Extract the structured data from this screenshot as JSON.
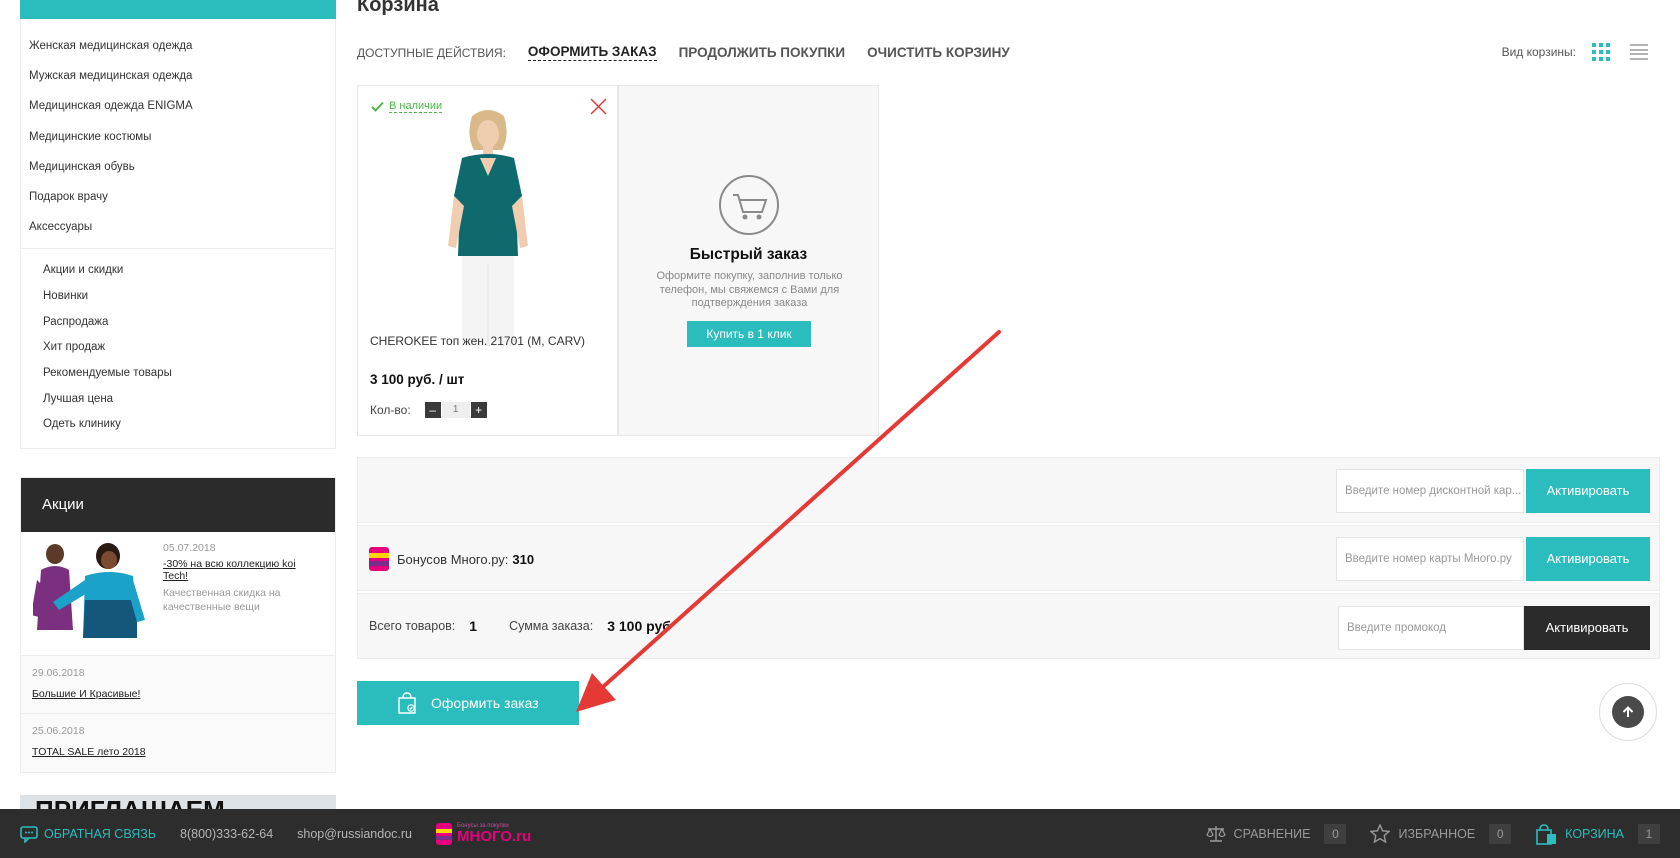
{
  "sidebar": {
    "categories": [
      "Женская медицинская одежда",
      "Мужская медицинская одежда",
      "Медицинская одежда ENIGMA",
      "Медицинские костюмы",
      "Медицинская обувь",
      "Подарок врачу",
      "Аксессуары"
    ],
    "subitems": [
      "Акции и скидки",
      "Новинки",
      "Распродажа",
      "Хит продаж",
      "Рекомендуемые товары",
      "Лучшая цена",
      "Одеть клинику"
    ],
    "promo": {
      "title": "Акции",
      "main": {
        "date": "05.07.2018",
        "link": "-30% на всю коллекцию koi Tech!",
        "desc": "Качественная скидка на качественные вещи"
      },
      "news": [
        {
          "date": "29.06.2018",
          "link": "Большие И Красивые!"
        },
        {
          "date": "25.06.2018",
          "link": "TOTAL SALE лето 2018"
        }
      ]
    },
    "banner_text": "ПРИГЛАШАЕМ"
  },
  "page": {
    "title": "Корзина",
    "actions_label": "ДОСТУПНЫЕ ДЕЙСТВИЯ:",
    "actions": [
      "ОФОРМИТЬ ЗАКАЗ",
      "ПРОДОЛЖИТЬ ПОКУПКИ",
      "ОЧИСТИТЬ КОРЗИНУ"
    ],
    "view_label": "Вид корзины:"
  },
  "product": {
    "stock": "В наличии",
    "name": "CHEROKEE топ жен. 21701 (M, CARV)",
    "price": "3 100 руб. / шт",
    "qty_label": "Кол-во:",
    "qty": "1",
    "minus": "–",
    "plus": "+"
  },
  "quick_order": {
    "title": "Быстрый заказ",
    "desc": "Оформите покупку, заполнив только телефон, мы свяжемся с Вами для подтверждения заказа",
    "button": "Купить в 1 клик"
  },
  "discount": {
    "placeholder": "Введите номер дисконтной кар...",
    "button": "Активировать"
  },
  "bonus": {
    "label": "Бонусов Много.ру:",
    "value": "310",
    "placeholder": "Введите номер карты Много.ру",
    "button": "Активировать"
  },
  "summary": {
    "items_label": "Всего товаров:",
    "items_value": "1",
    "sum_label": "Сумма заказа:",
    "sum_value": "3 100 руб",
    "promo_placeholder": "Введите промокод",
    "button": "Активировать"
  },
  "checkout_button": "Оформить заказ",
  "footer": {
    "feedback": "ОБРАТНАЯ СВЯЗЬ",
    "phone": "8(800)333-62-64",
    "email": "shop@russiandoc.ru",
    "mnogo_tagline": "Бонусы за покупки",
    "mnogo_logo": "МНОГО.ru",
    "compare": "СРАВНЕНИЕ",
    "compare_count": "0",
    "favorites": "ИЗБРАННОЕ",
    "favorites_count": "0",
    "cart": "КОРЗИНА",
    "cart_count": "1"
  },
  "colors": {
    "accent": "#2bbdbd",
    "dark": "#2b2b2b",
    "annotation_arrow": "#e53935",
    "in_stock": "#4db64d"
  },
  "icons": [
    "checkmark-icon",
    "close-icon",
    "cart-icon",
    "bag-icon",
    "arrow-up-icon",
    "chat-icon",
    "scales-icon",
    "star-icon",
    "shopping-bag-icon",
    "grid-view-icon",
    "list-view-icon"
  ]
}
